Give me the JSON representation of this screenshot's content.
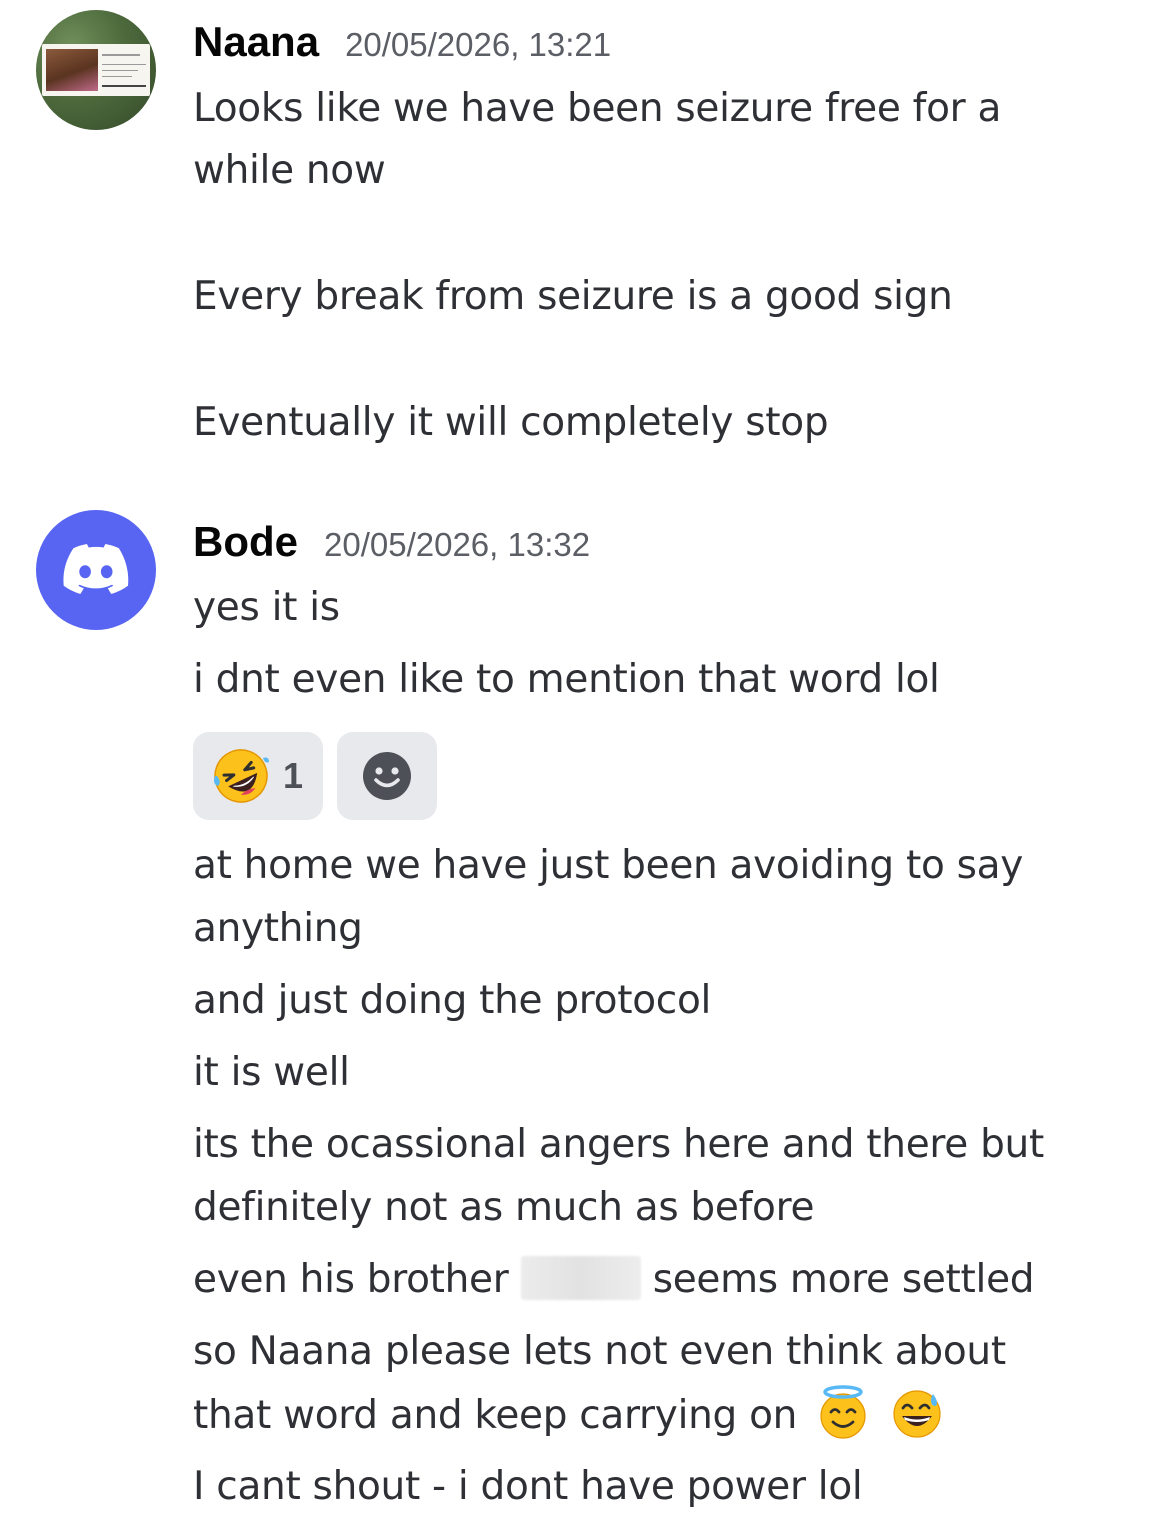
{
  "messages": [
    {
      "author": "Naana",
      "timestamp": "20/05/2026, 13:21",
      "avatar_icon": "profile-photo-avatar",
      "avatar_card_text": "Naana Simmons",
      "lines": [
        "Looks like we have been seizure free for a",
        "while now",
        "Every break from seizure is a good sign",
        "Eventually it will completely stop"
      ]
    },
    {
      "author": "Bode",
      "timestamp": "20/05/2026, 13:32",
      "avatar_icon": "discord-logo-icon",
      "avatar_color": "#5865f2",
      "lines_before_reactions": [
        "yes it is",
        "i dnt even like to mention that word lol"
      ],
      "reactions": [
        {
          "emoji": "rolling-on-floor-laughing",
          "count": "1"
        },
        {
          "emoji": "add-reaction-smiley-icon"
        }
      ],
      "lines_after_reactions": [
        "at home we have just been avoiding to say",
        "anything",
        "and just doing the protocol",
        "it is well",
        "its the ocassional angers here and there but",
        "definitely not as much as before",
        {
          "before": "even his brother",
          "after": "seems more settled"
        },
        "so Naana please lets not even think about",
        "that word and keep carrying on",
        "I cant shout - i dont have power lol"
      ],
      "inline_emojis": [
        "smiling-face-with-halo-icon",
        "grinning-face-with-sweat-icon"
      ]
    }
  ],
  "colors": {
    "username": "#060607",
    "timestamp": "#5c5e66",
    "text": "#2e3035",
    "reaction_bg": "#e8e9ec",
    "discord_blurple": "#5865f2"
  }
}
